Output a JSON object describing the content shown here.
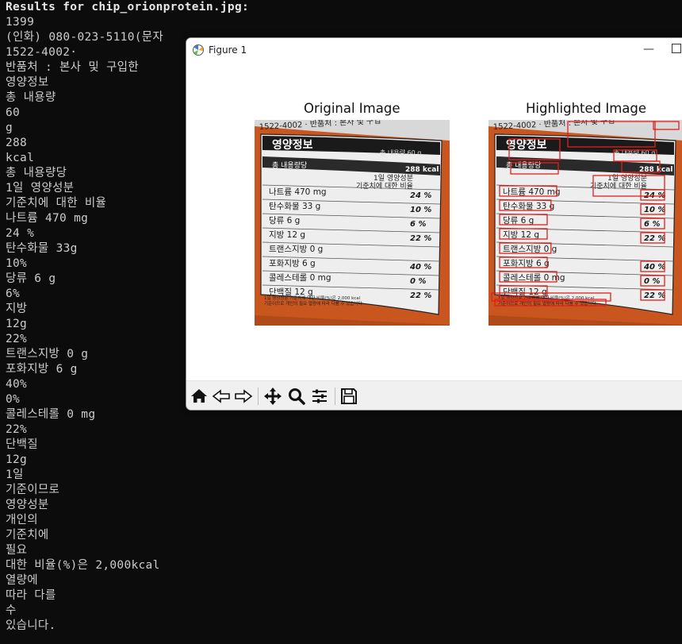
{
  "terminal": {
    "lines": [
      "Results for chip_orionprotein.jpg:",
      "1399",
      "(인화) 080-023-5110(문자",
      "1522-4002·",
      "반품처 : 본사 및 구입한",
      "영양정보",
      "총 내용량",
      "60",
      "g",
      "288",
      "kcal",
      "총 내용량당",
      "1일 영양성분",
      "기준치에 대한 비율",
      "나트륨 470 mg",
      "24 %",
      "탄수화물 33g",
      "10%",
      "당류 6 g",
      "6%",
      "지방",
      "12g",
      "22%",
      "트랜스지방 0 g",
      "포화지방 6 g",
      "40%",
      "0%",
      "콜레스테롤 0 mg",
      "22%",
      "단백질",
      "12g",
      "1일",
      "기준이므로",
      "영양성분",
      "개인의",
      "기준치에",
      "필요",
      "대한 비율(%)은 2,000kcal",
      "열량에",
      "따라 다를",
      "수",
      "있습니다."
    ]
  },
  "figure": {
    "window_title": "Figure 1",
    "min_glyph": "—",
    "axes": [
      {
        "title": "Original Image"
      },
      {
        "title": "Highlighted Image"
      }
    ],
    "label": {
      "top_strip": "1522-4002 · 반품처 : 본사 및 구입",
      "heading": "영양정보",
      "total_amount": "총 내용량 60 g",
      "kcal": "288 kcal",
      "per_total": "총 내용량당",
      "daily_ref": "1일 영양성분",
      "daily_ref2": "기준치에 대한 비율",
      "rows": [
        {
          "name": "나트륨 470 mg",
          "pct": "24 %"
        },
        {
          "name": "탄수화물 33 g",
          "pct": "10 %"
        },
        {
          "name": "당류 6 g",
          "pct": "6 %"
        },
        {
          "name": "지방 12 g",
          "pct": "22 %"
        },
        {
          "name": "트랜스지방 0 g",
          "pct": ""
        },
        {
          "name": "포화지방 6 g",
          "pct": "40 %"
        },
        {
          "name": "콜레스테롤 0 mg",
          "pct": "0 %"
        },
        {
          "name": "단백질 12 g",
          "pct": "22 %"
        }
      ],
      "footnote1": "1일 영양성분 기준치에 대한 비율(%)은 2,000 kcal",
      "footnote2": "기준이므로 개인의 필요 열량에 따라 다를 수 있습니다."
    },
    "toolbar": [
      "home-icon",
      "back-icon",
      "forward-icon",
      "pan-icon",
      "zoom-icon",
      "configure-icon",
      "save-icon"
    ],
    "colors": {
      "highlight_box": "#e0201b",
      "packaging": "#c9561f",
      "label_bg": "#eeeeee"
    }
  }
}
